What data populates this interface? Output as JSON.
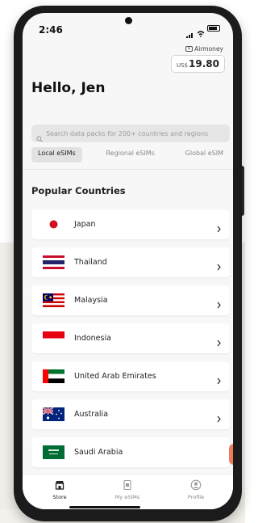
{
  "status_bar": {
    "time": "2:46"
  },
  "wallet": {
    "brand": "Airmoney",
    "currency": "US$",
    "amount": "19.80"
  },
  "greeting": "Hello, Jen",
  "search": {
    "placeholder": "Search data packs for 200+ countries and regions"
  },
  "tabs": [
    {
      "label": "Local eSIMs",
      "active": true
    },
    {
      "label": "Regional eSIMs",
      "active": false
    },
    {
      "label": "Global eSIM",
      "active": false
    }
  ],
  "section_title": "Popular Countries",
  "countries": [
    {
      "name": "Japan",
      "flag": "japan-flag-icon"
    },
    {
      "name": "Thailand",
      "flag": "thailand-flag-icon"
    },
    {
      "name": "Malaysia",
      "flag": "malaysia-flag-icon"
    },
    {
      "name": "Indonesia",
      "flag": "indonesia-flag-icon"
    },
    {
      "name": "United Arab Emirates",
      "flag": "uae-flag-icon"
    },
    {
      "name": "Australia",
      "flag": "australia-flag-icon"
    },
    {
      "name": "Saudi Arabia",
      "flag": "saudi-arabia-flag-icon"
    }
  ],
  "bottom_nav": [
    {
      "label": "Store",
      "icon": "store-icon",
      "active": true
    },
    {
      "label": "My eSIMs",
      "icon": "sim-card-icon",
      "active": false
    },
    {
      "label": "Profile",
      "icon": "profile-icon",
      "active": false
    }
  ],
  "colors": {
    "accent": "#ef7a5a",
    "background": "#f7f7f7",
    "card": "#ffffff"
  }
}
